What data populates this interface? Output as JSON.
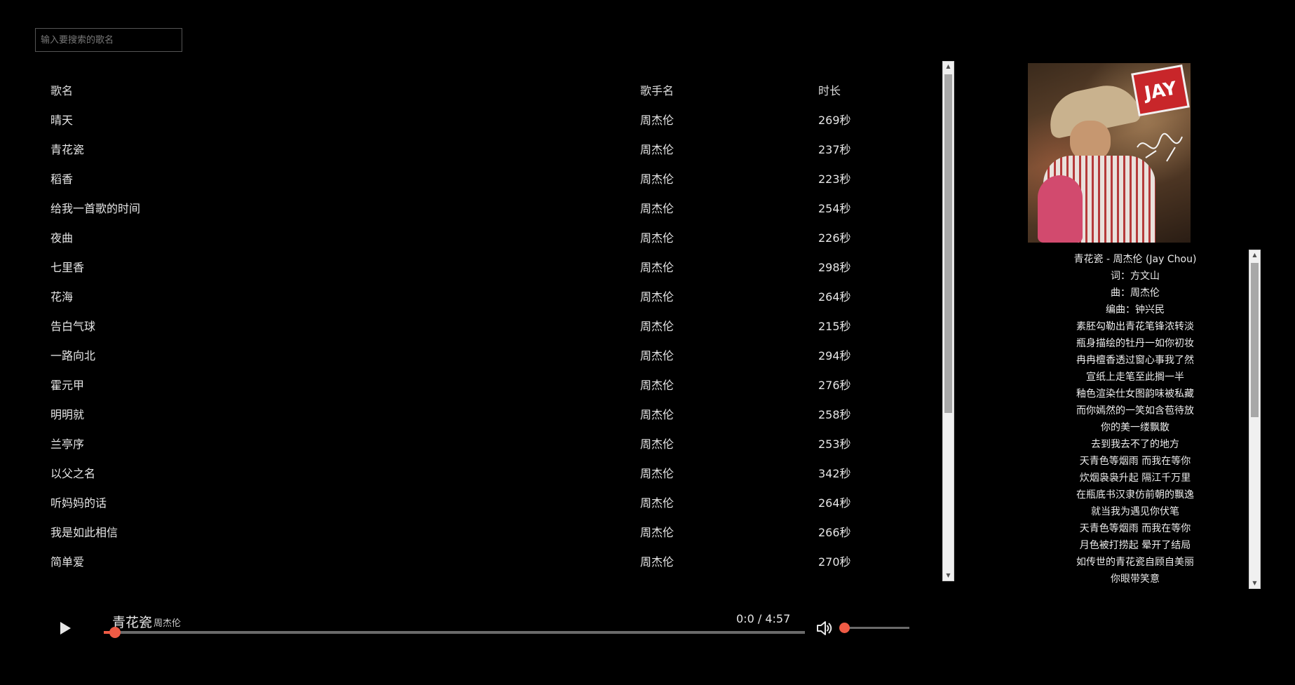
{
  "search": {
    "placeholder": "输入要搜索的歌名"
  },
  "table": {
    "headers": {
      "name": "歌名",
      "singer": "歌手名",
      "duration": "时长"
    },
    "rows": [
      {
        "name": "晴天",
        "singer": "周杰伦",
        "duration": "269秒"
      },
      {
        "name": "青花瓷",
        "singer": "周杰伦",
        "duration": "237秒"
      },
      {
        "name": "稻香",
        "singer": "周杰伦",
        "duration": "223秒"
      },
      {
        "name": "给我一首歌的时间",
        "singer": "周杰伦",
        "duration": "254秒"
      },
      {
        "name": "夜曲",
        "singer": "周杰伦",
        "duration": "226秒"
      },
      {
        "name": "七里香",
        "singer": "周杰伦",
        "duration": "298秒"
      },
      {
        "name": "花海",
        "singer": "周杰伦",
        "duration": "264秒"
      },
      {
        "name": "告白气球",
        "singer": "周杰伦",
        "duration": "215秒"
      },
      {
        "name": "一路向北",
        "singer": "周杰伦",
        "duration": "294秒"
      },
      {
        "name": "霍元甲",
        "singer": "周杰伦",
        "duration": "276秒"
      },
      {
        "name": "明明就",
        "singer": "周杰伦",
        "duration": "258秒"
      },
      {
        "name": "兰亭序",
        "singer": "周杰伦",
        "duration": "253秒"
      },
      {
        "name": "以父之名",
        "singer": "周杰伦",
        "duration": "342秒"
      },
      {
        "name": "听妈妈的话",
        "singer": "周杰伦",
        "duration": "264秒"
      },
      {
        "name": "我是如此相信",
        "singer": "周杰伦",
        "duration": "266秒"
      },
      {
        "name": "简单爱",
        "singer": "周杰伦",
        "duration": "270秒"
      }
    ]
  },
  "album_cover": {
    "logo_text": "JAY",
    "icon": "album-cover-image"
  },
  "lyrics": [
    "青花瓷 - 周杰伦 (Jay Chou)",
    "词：方文山",
    "曲：周杰伦",
    "编曲：钟兴民",
    "素胚勾勒出青花笔锋浓转淡",
    "瓶身描绘的牡丹一如你初妆",
    "冉冉檀香透过窗心事我了然",
    "宣纸上走笔至此搁一半",
    "釉色渲染仕女图韵味被私藏",
    "而你嫣然的一笑如含苞待放",
    "你的美一缕飘散",
    "去到我去不了的地方",
    "天青色等烟雨 而我在等你",
    "炊烟袅袅升起 隔江千万里",
    "在瓶底书汉隶仿前朝的飘逸",
    "就当我为遇见你伏笔",
    "天青色等烟雨 而我在等你",
    "月色被打捞起 晕开了结局",
    "如传世的青花瓷自顾自美丽",
    "你眼带笑意"
  ],
  "player": {
    "title": "青花瓷",
    "artist": "周杰伦",
    "time": "0:0 / 4:57",
    "progress_fraction": 0.016,
    "volume_fraction": 0.0,
    "accent_color": "#ef5b45",
    "icons": {
      "play": "play-icon",
      "volume": "volume-icon"
    }
  }
}
